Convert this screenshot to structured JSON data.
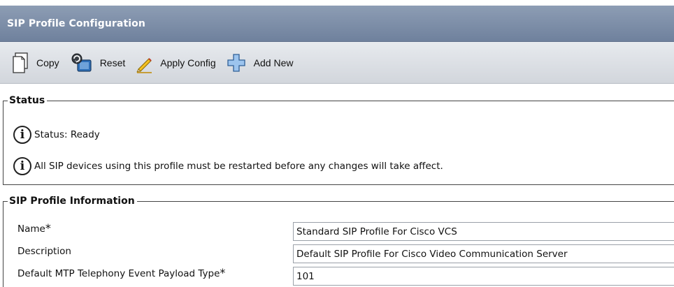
{
  "header": {
    "title": "SIP Profile Configuration"
  },
  "toolbar": {
    "items": [
      {
        "label": "Copy",
        "icon": "copy-icon"
      },
      {
        "label": "Reset",
        "icon": "reset-icon"
      },
      {
        "label": "Apply Config",
        "icon": "pencil-icon"
      },
      {
        "label": "Add New",
        "icon": "add-icon"
      }
    ]
  },
  "status": {
    "legend": "Status",
    "messages": [
      "Status: Ready",
      "All SIP devices using this profile must be restarted before any changes will take affect."
    ]
  },
  "profile_info": {
    "legend": "SIP Profile Information",
    "required_marker": "*",
    "fields": [
      {
        "label": "Name",
        "required": true,
        "value": "Standard SIP Profile For Cisco VCS"
      },
      {
        "label": "Description",
        "required": false,
        "value": "Default SIP Profile For Cisco Video Communication Server"
      },
      {
        "label": "Default MTP Telephony Event Payload Type",
        "required": true,
        "value": "101"
      }
    ]
  },
  "colors": {
    "title_bar": "#7d8ea8",
    "toolbar": "#dde0e5"
  }
}
